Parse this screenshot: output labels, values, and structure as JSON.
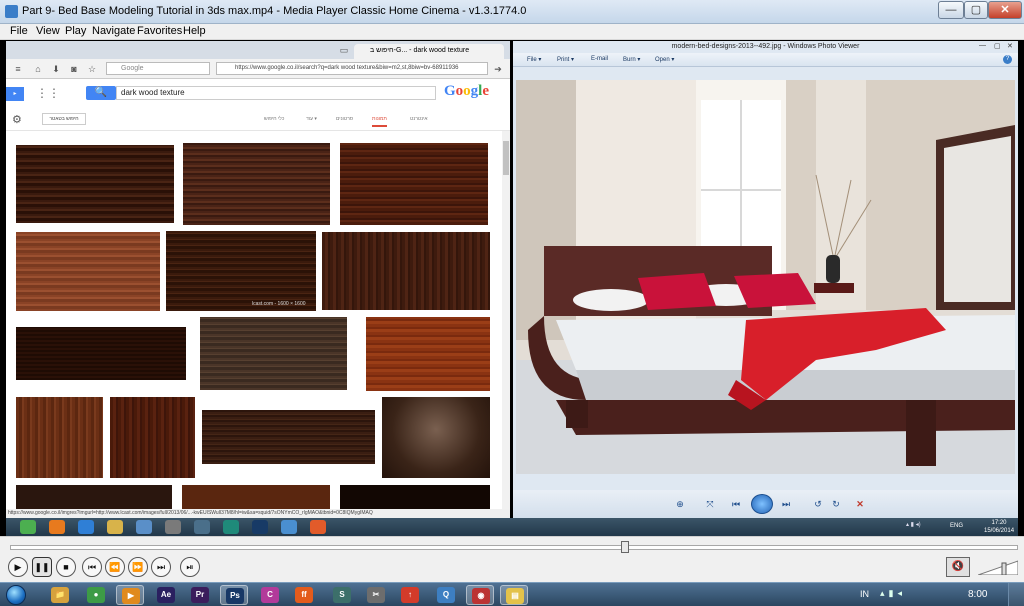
{
  "mpc": {
    "title": "Part 9- Bed Base Modeling Tutorial in 3ds max.mp4 - Media Player Classic Home Cinema - v1.3.1774.0",
    "menu": [
      "File",
      "View",
      "Play",
      "Navigate",
      "Favorites",
      "Help"
    ],
    "window_buttons": {
      "minimize": "—",
      "maximize": "▢",
      "close": "✕"
    }
  },
  "chrome": {
    "tab_title": "חיפוש ב-G... - dark wood texture",
    "search_placeholder": "Google",
    "url": "https://www.google.co.il/search?q=dark wood texture&biw=m2,st,8biw=bv-68911936",
    "google": {
      "query": "dark wood texture",
      "logo": "Google",
      "tools_label": "חיפוש בטאטר",
      "tabs": [
        "אינטרנט",
        "תמונות",
        "סרטונים",
        "עוד ▾",
        "כלי חיפוש"
      ],
      "hover_caption": "lcast.com - 1600 × 1600"
    },
    "status_url": "https://www.google.co.il/imgres?imgurl=http://www.lcast.com/images/full/2013/06/...-kwEUISWuIl37M8/hl=iw&sa=squid/7sONYmCO_rlgMAO&tbnid=0C8IQMygIMAQ"
  },
  "wpv": {
    "title": "modern-bed-designs-2013--492.jpg - Windows Photo Viewer",
    "menu": [
      "File ▾",
      "Print ▾",
      "E-mail",
      "Burn ▾",
      "Open ▾"
    ],
    "window_buttons": {
      "minimize": "—",
      "maximize": "▢",
      "close": "✕"
    }
  },
  "inner_taskbar": {
    "lang": "ENG",
    "time": "17:20",
    "date": "15/06/2014",
    "apps": [
      {
        "name": "Chrome",
        "color": "#4caf50"
      },
      {
        "name": "Firefox",
        "color": "#e87a1e"
      },
      {
        "name": "IE",
        "color": "#2f7fd6"
      },
      {
        "name": "Explorer",
        "color": "#d8b34a"
      },
      {
        "name": "Control",
        "color": "#5a8fc8"
      },
      {
        "name": "Tool",
        "color": "#7a7a7a"
      },
      {
        "name": "Util",
        "color": "#4a6f8a"
      },
      {
        "name": "3ds",
        "color": "#1f8a7a"
      },
      {
        "name": "Ps",
        "color": "#173a66"
      },
      {
        "name": "Viewer",
        "color": "#4a8fd0"
      },
      {
        "name": "Grid",
        "color": "#e25b2a"
      }
    ]
  },
  "player": {
    "buttons": [
      "▶",
      "❚❚",
      "■",
      "⏮",
      "⏪",
      "⏩",
      "⏭",
      "⏯"
    ],
    "seek_position": 0.61,
    "volume_icon": "🔇"
  },
  "taskbar": {
    "lang": "IN",
    "clock": "8:00",
    "apps": [
      {
        "label": "📁",
        "color": "#d6a23d",
        "active": false
      },
      {
        "label": "●",
        "color": "#3d9b46",
        "active": false
      },
      {
        "label": "▶",
        "color": "#e08a1e",
        "active": true
      },
      {
        "label": "Ae",
        "color": "#2a2060",
        "active": false
      },
      {
        "label": "Pr",
        "color": "#3b1d5c",
        "active": false
      },
      {
        "label": "Ps",
        "color": "#183866",
        "active": true
      },
      {
        "label": "C",
        "color": "#b23a9a",
        "active": false
      },
      {
        "label": "ff",
        "color": "#e35b1c",
        "active": false
      },
      {
        "label": "S",
        "color": "#3c6f6a",
        "active": false
      },
      {
        "label": "✂",
        "color": "#6d6d6d",
        "active": false
      },
      {
        "label": "↑",
        "color": "#d33b2a",
        "active": false
      },
      {
        "label": "Q",
        "color": "#3d7fc2",
        "active": false
      },
      {
        "label": "◉",
        "color": "#b33",
        "active": true
      },
      {
        "label": "▤",
        "color": "#e3c24a",
        "active": true
      }
    ]
  }
}
